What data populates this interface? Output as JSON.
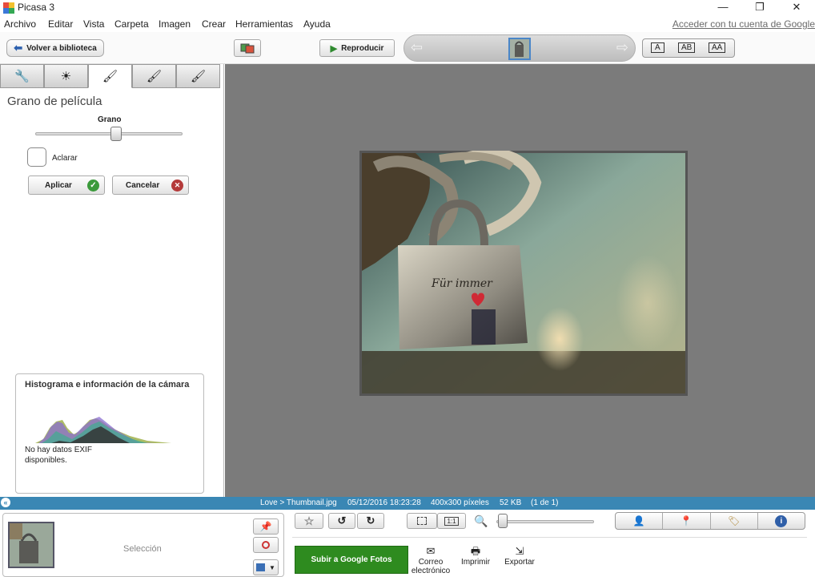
{
  "app": {
    "title": "Picasa 3"
  },
  "window": {
    "minimize": "—",
    "restore": "❐",
    "close": "✕"
  },
  "menu": [
    "Archivo",
    "Editar",
    "Vista",
    "Carpeta",
    "Imagen",
    "Crear",
    "Herramientas",
    "Ayuda"
  ],
  "signin_link": "Acceder con tu cuenta de Google",
  "toolbar": {
    "back_label": "Volver a biblioteca",
    "play_label": "Reproducir",
    "text_size_buttons": [
      "A",
      "AB",
      "AA"
    ]
  },
  "edit_tabs": [
    {
      "icon": "wrench-icon",
      "glyph": "🔧"
    },
    {
      "icon": "brightness-icon",
      "glyph": "☀"
    },
    {
      "icon": "brush-icon",
      "glyph": "🖌"
    },
    {
      "icon": "brush-green-icon",
      "glyph": "🖌"
    },
    {
      "icon": "brush-blue-icon",
      "glyph": "🖌"
    }
  ],
  "effect_panel": {
    "title": "Grano de película",
    "slider_label": "Grano",
    "slider_value": 0.55,
    "checkbox_label": "Aclarar",
    "checkbox_checked": false,
    "apply_label": "Aplicar",
    "cancel_label": "Cancelar"
  },
  "histogram": {
    "title": "Histograma e información de la cámara",
    "exif_text_line1": "No hay datos EXIF",
    "exif_text_line2": "disponibles."
  },
  "photo": {
    "engraving": "Für immer"
  },
  "status": {
    "path": "Love > Thumbnail.jpg",
    "datetime": "05/12/2016 18:23:28",
    "dimensions": "400x300 píxeles",
    "size": "52 KB",
    "index": "(1 de 1)"
  },
  "tray": {
    "selection_label": "Selección",
    "upload_label": "Subir a Google Fotos",
    "email_label_line1": "Correo",
    "email_label_line2": "electrónico",
    "print_label": "Imprimir",
    "export_label": "Exportar",
    "zoom_level": 0.0,
    "ratio_label": "1:1"
  },
  "colors": {
    "status_bar": "#3a87b4",
    "upload_button": "#2e8b1f",
    "viewer_bg": "#7b7b7b"
  }
}
